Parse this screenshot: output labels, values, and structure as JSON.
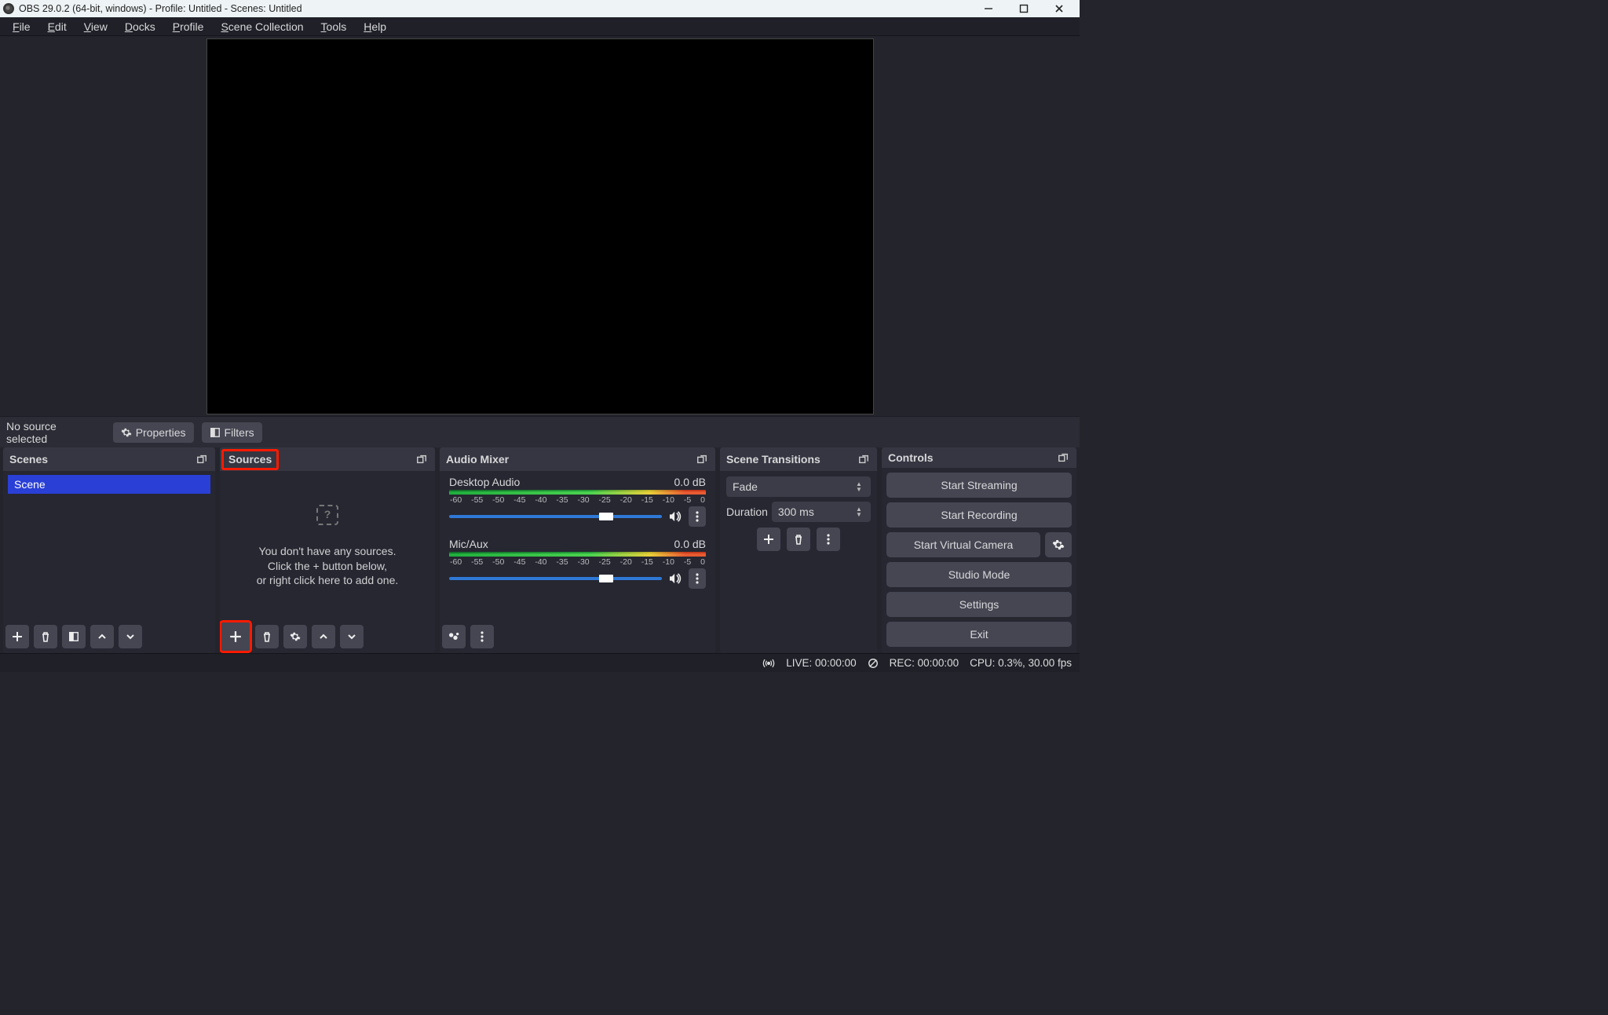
{
  "titlebar": {
    "text": "OBS 29.0.2 (64-bit, windows) - Profile: Untitled - Scenes: Untitled"
  },
  "menubar": {
    "items": [
      "File",
      "Edit",
      "View",
      "Docks",
      "Profile",
      "Scene Collection",
      "Tools",
      "Help"
    ]
  },
  "midbar": {
    "status": "No source selected",
    "properties": "Properties",
    "filters": "Filters"
  },
  "panels": {
    "scenes": {
      "title": "Scenes",
      "items": [
        "Scene"
      ]
    },
    "sources": {
      "title": "Sources",
      "empty": {
        "line1": "You don't have any sources.",
        "line2": "Click the + button below,",
        "line3": "or right click here to add one."
      }
    },
    "mixer": {
      "title": "Audio Mixer",
      "channels": [
        {
          "name": "Desktop Audio",
          "db": "0.0 dB"
        },
        {
          "name": "Mic/Aux",
          "db": "0.0 dB"
        }
      ],
      "ticks": [
        "-60",
        "-55",
        "-50",
        "-45",
        "-40",
        "-35",
        "-30",
        "-25",
        "-20",
        "-15",
        "-10",
        "-5",
        "0"
      ]
    },
    "transitions": {
      "title": "Scene Transitions",
      "type": "Fade",
      "duration_label": "Duration",
      "duration_value": "300 ms"
    },
    "controls": {
      "title": "Controls",
      "buttons": {
        "streaming": "Start Streaming",
        "recording": "Start Recording",
        "vcam": "Start Virtual Camera",
        "studio": "Studio Mode",
        "settings": "Settings",
        "exit": "Exit"
      }
    }
  },
  "statusbar": {
    "live": "LIVE: 00:00:00",
    "rec": "REC: 00:00:00",
    "cpu": "CPU: 0.3%, 30.00 fps"
  }
}
